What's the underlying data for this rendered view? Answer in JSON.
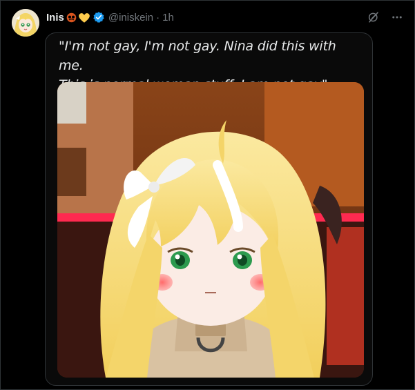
{
  "post": {
    "author_name": "Inis",
    "handle": "@iniskein",
    "separator": "·",
    "time": "1h",
    "name_emojis": [
      "pretzel-emoji",
      "yellow-heart-emoji"
    ],
    "verified": true
  },
  "quote": {
    "line1": "\"I'm not gay, I'm not gay. Nina did this with me.",
    "line2": "This is normal woman stuff. I am not gay\""
  },
  "icons": [
    "grok-icon",
    "more-options-icon",
    "verified-badge-icon"
  ],
  "colors": {
    "background": "#000000",
    "text": "#e7e9ea",
    "muted": "#71767b",
    "border": "#2f3336",
    "verified": "#1d9bf0"
  }
}
